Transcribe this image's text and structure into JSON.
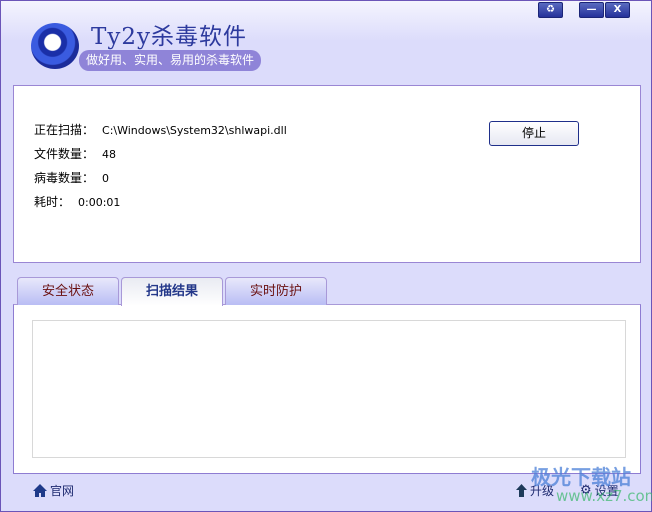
{
  "app": {
    "title": "Ty2y杀毒软件",
    "slogan": "做好用、实用、易用的杀毒软件"
  },
  "window_buttons": {
    "skin": "♻",
    "minimize": "—",
    "close": "X"
  },
  "scan": {
    "scanning_label": "正在扫描：",
    "scanning_value": "C:\\Windows\\System32\\shlwapi.dll",
    "files_label": "文件数量：",
    "files_value": "48",
    "virus_label": "病毒数量：",
    "virus_value": "0",
    "time_label": "耗时：",
    "time_value": "0:00:01",
    "stop_label": "停止"
  },
  "tabs": [
    {
      "label": "安全状态"
    },
    {
      "label": "扫描结果"
    },
    {
      "label": "实时防护"
    }
  ],
  "footer": {
    "website": "官网",
    "upgrade": "升级",
    "settings": "设置"
  },
  "watermark": {
    "name": "极光下载站",
    "url": "www.xz7.com"
  }
}
